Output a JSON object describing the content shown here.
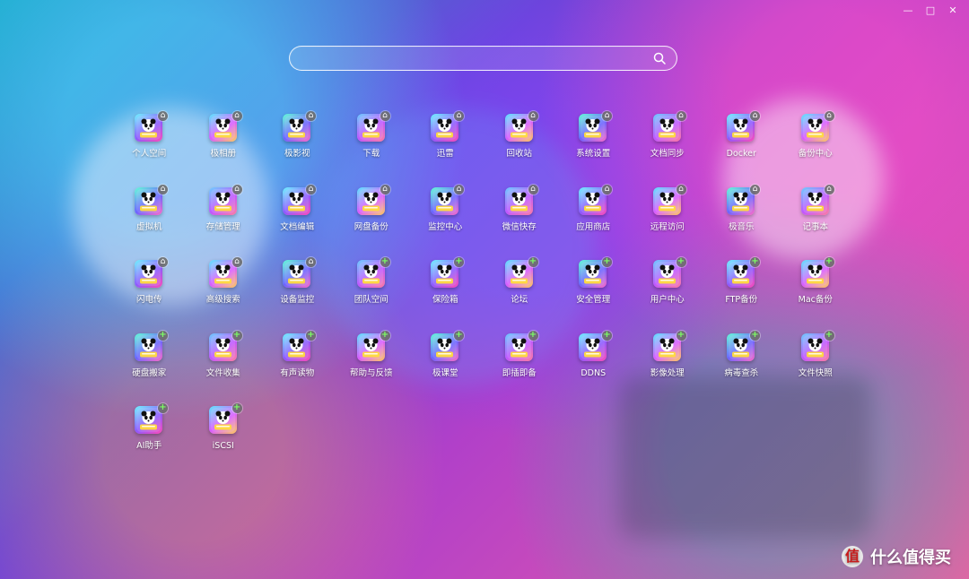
{
  "window": {
    "controls": [
      {
        "label": "—",
        "icon": "minimize-icon"
      },
      {
        "label": "□",
        "icon": "maximize-icon"
      },
      {
        "label": "✕",
        "icon": "close-icon"
      }
    ]
  },
  "search": {
    "value": "",
    "placeholder": "",
    "icon": "search-icon"
  },
  "apps": [
    {
      "label": "个人空间",
      "icon": "personal-space-icon",
      "badge": "⌂"
    },
    {
      "label": "极相册",
      "icon": "photo-album-icon",
      "badge": "⌂"
    },
    {
      "label": "极影视",
      "icon": "video-icon",
      "badge": "⌂"
    },
    {
      "label": "下载",
      "icon": "download-icon",
      "badge": "⌂"
    },
    {
      "label": "迅雷",
      "icon": "thunder-icon",
      "badge": "⌂"
    },
    {
      "label": "回收站",
      "icon": "recycle-bin-icon",
      "badge": "⌂"
    },
    {
      "label": "系统设置",
      "icon": "system-settings-icon",
      "badge": "⌂"
    },
    {
      "label": "文档同步",
      "icon": "document-sync-icon",
      "badge": "⌂"
    },
    {
      "label": "Docker",
      "icon": "docker-icon",
      "badge": "⌂"
    },
    {
      "label": "备份中心",
      "icon": "backup-center-icon",
      "badge": "⌂"
    },
    {
      "label": "虚拟机",
      "icon": "virtual-machine-icon",
      "badge": "⌂"
    },
    {
      "label": "存储管理",
      "icon": "storage-management-icon",
      "badge": "⌂"
    },
    {
      "label": "文档编辑",
      "icon": "document-edit-icon",
      "badge": "⌂"
    },
    {
      "label": "网盘备份",
      "icon": "cloud-backup-icon",
      "badge": "⌂"
    },
    {
      "label": "监控中心",
      "icon": "monitoring-center-icon",
      "badge": "⌂"
    },
    {
      "label": "微信快存",
      "icon": "wechat-save-icon",
      "badge": "⌂"
    },
    {
      "label": "应用商店",
      "icon": "app-store-icon",
      "badge": "⌂"
    },
    {
      "label": "远程访问",
      "icon": "remote-access-icon",
      "badge": "⌂"
    },
    {
      "label": "极音乐",
      "icon": "music-icon",
      "badge": "⌂"
    },
    {
      "label": "记事本",
      "icon": "notepad-icon",
      "badge": "⌂"
    },
    {
      "label": "闪电传",
      "icon": "quick-transfer-icon",
      "badge": "⌂"
    },
    {
      "label": "高级搜索",
      "icon": "advanced-search-icon",
      "badge": "⌂"
    },
    {
      "label": "设备监控",
      "icon": "device-monitor-icon",
      "badge": "⌂"
    },
    {
      "label": "团队空间",
      "icon": "team-space-icon",
      "badge": "+"
    },
    {
      "label": "保险箱",
      "icon": "safe-box-icon",
      "badge": "+"
    },
    {
      "label": "论坛",
      "icon": "forum-icon",
      "badge": "+"
    },
    {
      "label": "安全管理",
      "icon": "security-management-icon",
      "badge": "+"
    },
    {
      "label": "用户中心",
      "icon": "user-center-icon",
      "badge": "+"
    },
    {
      "label": "FTP备份",
      "icon": "ftp-backup-icon",
      "badge": "+"
    },
    {
      "label": "Mac备份",
      "icon": "mac-backup-icon",
      "badge": "+"
    },
    {
      "label": "硬盘搬家",
      "icon": "disk-migration-icon",
      "badge": "+"
    },
    {
      "label": "文件收集",
      "icon": "file-collection-icon",
      "badge": "+"
    },
    {
      "label": "有声读物",
      "icon": "audiobook-icon",
      "badge": "+"
    },
    {
      "label": "帮助与反馈",
      "icon": "help-feedback-icon",
      "badge": "+"
    },
    {
      "label": "极课堂",
      "icon": "classroom-icon",
      "badge": "+"
    },
    {
      "label": "即插即备",
      "icon": "plug-backup-icon",
      "badge": "+"
    },
    {
      "label": "DDNS",
      "icon": "ddns-icon",
      "badge": "+"
    },
    {
      "label": "影像处理",
      "icon": "image-processing-icon",
      "badge": "+"
    },
    {
      "label": "病毒查杀",
      "icon": "virus-scan-icon",
      "badge": "+"
    },
    {
      "label": "文件快照",
      "icon": "file-snapshot-icon",
      "badge": "+"
    },
    {
      "label": "AI助手",
      "icon": "ai-assistant-icon",
      "badge": "+"
    },
    {
      "label": "iSCSI",
      "icon": "iscsi-icon",
      "badge": "+"
    }
  ],
  "watermark": {
    "logo": "值",
    "text": "什么值得买"
  }
}
